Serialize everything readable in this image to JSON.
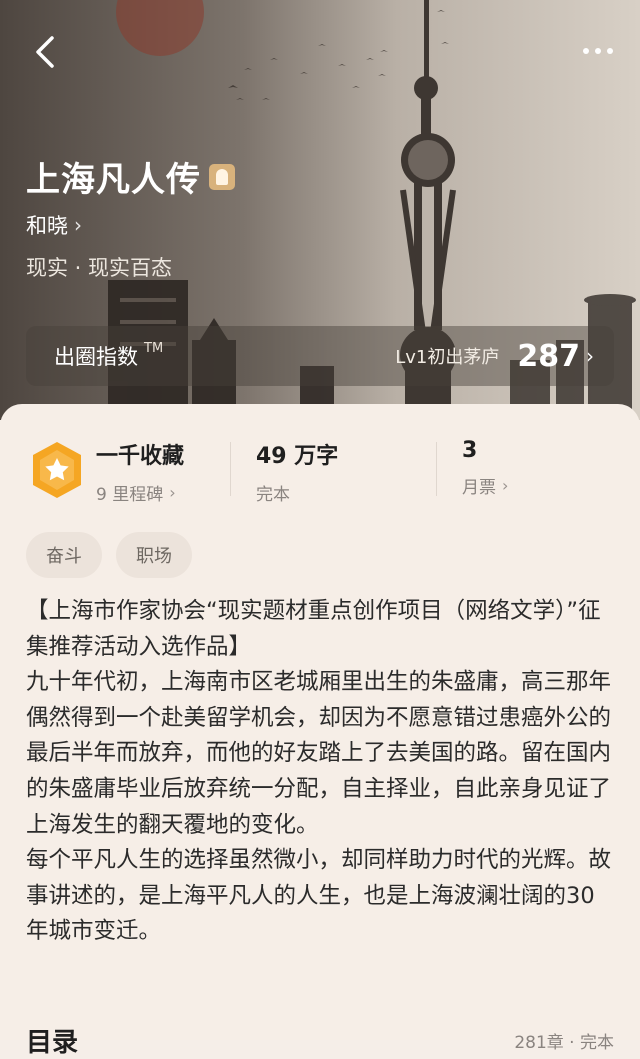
{
  "book": {
    "title": "上海凡人传",
    "author": "和晓",
    "genre": "现实 · 现实百态"
  },
  "index_bar": {
    "label": "出圈指数",
    "tm": "TM",
    "level": "Lv1初出茅庐",
    "value": "287"
  },
  "stats": {
    "collection": {
      "main": "一千收藏",
      "sub": "9 里程碑"
    },
    "words": {
      "main": "49 万字",
      "sub": "完本"
    },
    "monthly": {
      "main": "3",
      "sub": "月票"
    }
  },
  "tags": [
    "奋斗",
    "职场"
  ],
  "synopsis": [
    "【上海市作家协会“现实题材重点创作项目（网络文学）”征集推荐活动入选作品】",
    "九十年代初，上海南市区老城厢里出生的朱盛庸，高三那年偶然得到一个赴美留学机会，却因为不愿意错过患癌外公的最后半年而放弃，而他的好友踏上了去美国的路。留在国内的朱盛庸毕业后放弃统一分配，自主择业，自此亲身见证了上海发生的翻天覆地的变化。",
    "每个平凡人生的选择虽然微小，却同样助力时代的光辉。故事讲述的，是上海平凡人的人生，也是上海波澜壮阔的30年城市变迁。"
  ],
  "toc": {
    "title": "目录",
    "meta": "281章 · 完本"
  },
  "icons": {
    "back": "back-arrow-icon",
    "more": "more-dots-icon",
    "title_badge": "badge-icon",
    "medal": "star-medal-icon"
  },
  "colors": {
    "medal": "#f5a623",
    "card_bg": "#f6eee7",
    "tag_bg": "#ece3db"
  }
}
